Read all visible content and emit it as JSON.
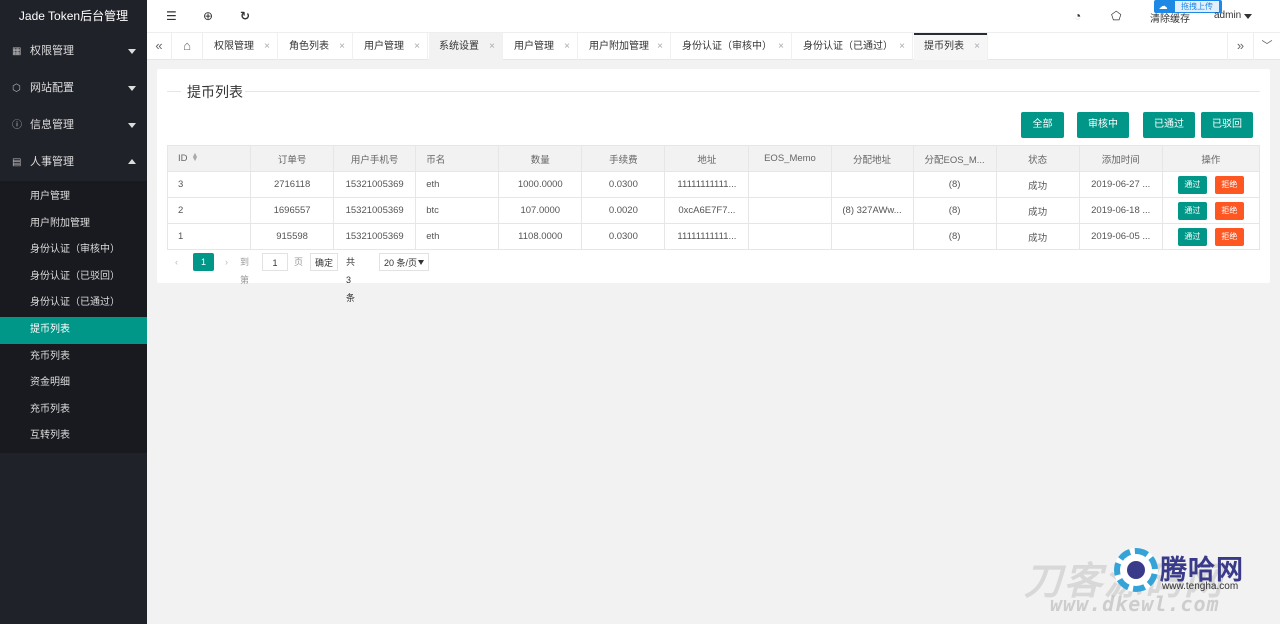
{
  "app": {
    "title": "Jade Token后台管理"
  },
  "sidebar": {
    "groups": [
      {
        "label": "权限管理",
        "icon": "permission-icon",
        "expanded": false
      },
      {
        "label": "网站配置",
        "icon": "website-icon",
        "expanded": false
      },
      {
        "label": "信息管理",
        "icon": "info-icon",
        "expanded": false
      },
      {
        "label": "人事管理",
        "icon": "personnel-icon",
        "expanded": true
      }
    ],
    "items": [
      {
        "label": "用户管理"
      },
      {
        "label": "用户附加管理"
      },
      {
        "label": "身份认证（审核中）"
      },
      {
        "label": "身份认证（已驳回）"
      },
      {
        "label": "身份认证（已通过）"
      },
      {
        "label": "提币列表",
        "active": true
      },
      {
        "label": "充币列表"
      },
      {
        "label": "资金明细"
      },
      {
        "label": "充币列表"
      },
      {
        "label": "互转列表"
      }
    ]
  },
  "header": {
    "icons": [
      "menu-toggle-icon",
      "globe-icon",
      "refresh-icon",
      "theme-icon",
      "tag-icon"
    ],
    "upload_label": "拖拽上传",
    "clear_cache": "清除缓存",
    "user": "admin"
  },
  "tabs": [
    {
      "label": "权限管理"
    },
    {
      "label": "角色列表"
    },
    {
      "label": "用户管理"
    },
    {
      "label": "系统设置"
    },
    {
      "label": "用户管理"
    },
    {
      "label": "用户附加管理"
    },
    {
      "label": "身份认证（审核中）"
    },
    {
      "label": "身份认证（已通过）"
    },
    {
      "label": "提币列表",
      "active": true
    }
  ],
  "tab_close": "×",
  "page": {
    "legend": "提币列表",
    "filters": [
      {
        "label": "全部"
      },
      {
        "label": "审核中"
      },
      {
        "label": "已通过"
      },
      {
        "label": "已驳回"
      }
    ]
  },
  "table": {
    "columns": [
      "ID",
      "订单号",
      "用户手机号",
      "币名",
      "数量",
      "手续费",
      "地址",
      "EOS_Memo",
      "分配地址",
      "分配EOS_M...",
      "状态",
      "添加时间",
      "操作"
    ],
    "rows": [
      {
        "id": "3",
        "order": "2716118",
        "phone": "15321005369",
        "coin": "eth",
        "amount": "1000.0000",
        "fee": "0.0300",
        "address": "11111111111...",
        "memo": "",
        "assign_addr": "",
        "assign_memo": "(8)",
        "status": "成功",
        "time": "2019-06-27 ..."
      },
      {
        "id": "2",
        "order": "1696557",
        "phone": "15321005369",
        "coin": "btc",
        "amount": "107.0000",
        "fee": "0.0020",
        "address": "0xcA6E7F7...",
        "memo": "",
        "assign_addr": "(8) 327AWw...",
        "assign_memo": "(8)",
        "status": "成功",
        "time": "2019-06-18 ..."
      },
      {
        "id": "1",
        "order": "915598",
        "phone": "15321005369",
        "coin": "eth",
        "amount": "1108.0000",
        "fee": "0.0300",
        "address": "11111111111...",
        "memo": "",
        "assign_addr": "",
        "assign_memo": "(8)",
        "status": "成功",
        "time": "2019-06-05 ..."
      }
    ],
    "actions": {
      "pass": "通过",
      "reject": "拒绝"
    }
  },
  "pager": {
    "current": "1",
    "goto_label": "到第",
    "input_value": "1",
    "page_label": "页",
    "confirm": "确定",
    "total": "共 3 条",
    "page_size": "20 条/页"
  },
  "watermark": {
    "big": "刀客源码网",
    "url": "www.dkewl.com",
    "brand": "腾哈网",
    "sub": "www.tengha.com"
  },
  "colors": {
    "accent": "#009688",
    "danger": "#ff5722",
    "sidebar": "#20222a"
  }
}
